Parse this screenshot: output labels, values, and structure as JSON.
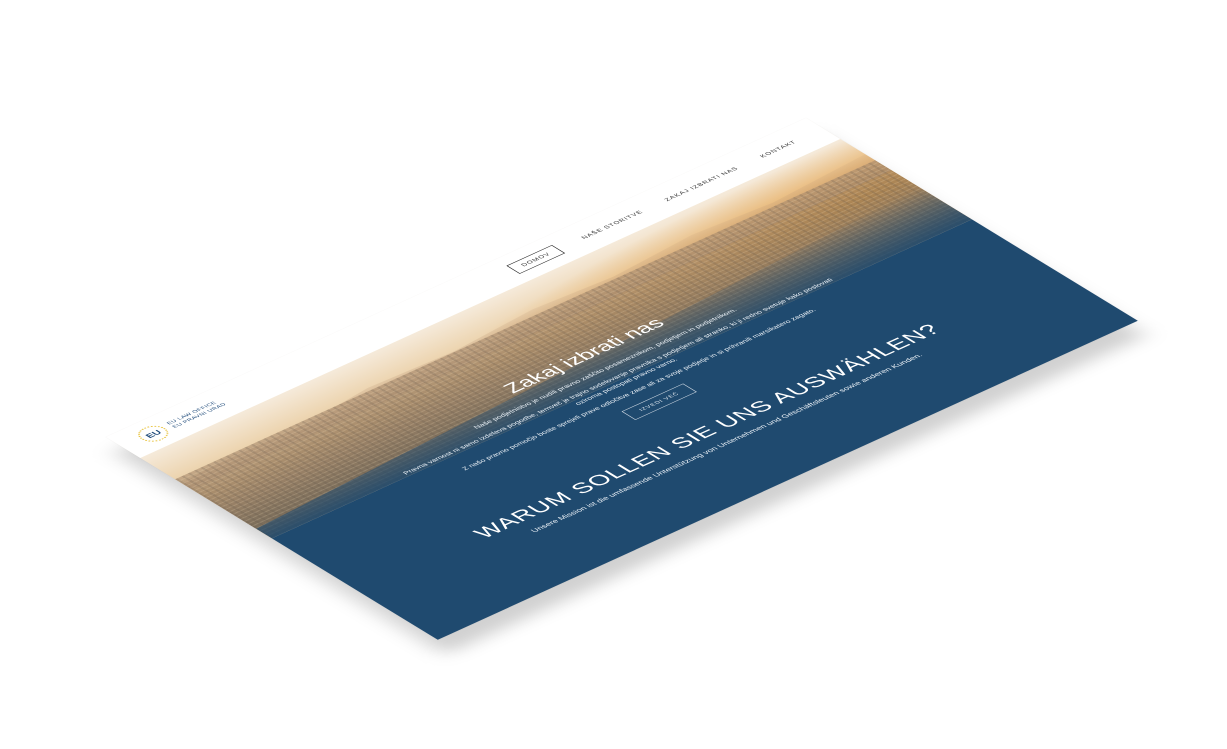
{
  "header": {
    "logo_mark": "EU",
    "logo_line1": "EU LAW OFFICE",
    "logo_line2": "EU PRAVNI URAD",
    "nav": [
      {
        "label": "DOMOV",
        "active": true
      },
      {
        "label": "NAŠE STORITVE",
        "active": false
      },
      {
        "label": "ZAKAJ IZBRATI NAS",
        "active": false
      },
      {
        "label": "KONTAKT",
        "active": false
      }
    ]
  },
  "section_sl": {
    "title": "Zakaj izbrati nas",
    "p1": "Naše podjetnistvo je nudili pravno zaščito posameznikom, podjetjem in podjetnikom.",
    "p2": "Pravna varnost ni samo izdelava pogodbe, temveč je trajno sodelovanje pravnika s podjetjem ali stranko, ki ji redno svetuje kako poslovati oziroma postopati pravno varno.",
    "p3": "Z našo pravno pomočjo boste sprejeli prave odločitve zase ali za svoje podjetje in si prihranili marsikatero zagato.",
    "button": "IZVEDI VEČ"
  },
  "section_de": {
    "title": "WARUM SOLLEN SIE UNS AUSWÄHLEN?",
    "p1": "Unsere Mission ist die umfassende Unterstützung von Unternehmen und Geschäftsleuten sowie anderen Kunden."
  },
  "colors": {
    "navy": "#1f4a6f",
    "gold": "#e8c23a"
  }
}
